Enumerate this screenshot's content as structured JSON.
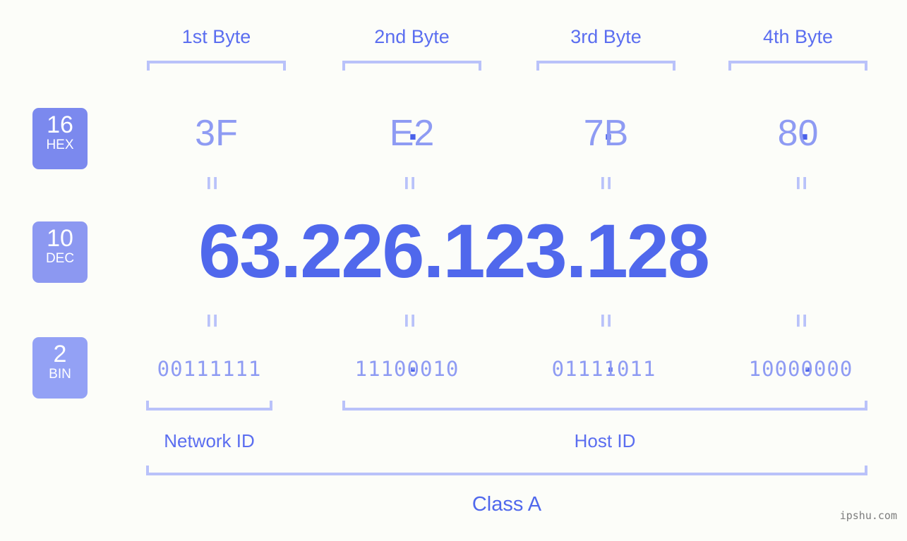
{
  "background_color": "#fcfdf9",
  "accent_color": "#5068ec",
  "muted_accent_color": "#8e9bf3",
  "bracket_color": "#b9c2fa",
  "byte_headers": [
    {
      "label": "1st Byte"
    },
    {
      "label": "2nd Byte"
    },
    {
      "label": "3rd Byte"
    },
    {
      "label": "4th Byte"
    }
  ],
  "rows": {
    "hex": {
      "badge_number": "16",
      "badge_abbr": "HEX",
      "badge_color": "#7b89ee",
      "separator": ".",
      "values": [
        "3F",
        "E2",
        "7B",
        "80"
      ]
    },
    "dec": {
      "badge_number": "10",
      "badge_abbr": "DEC",
      "badge_color": "#8c98f1",
      "separator": ".",
      "values": [
        "63",
        "226",
        "123",
        "128"
      ],
      "full_value": "63.226.123.128"
    },
    "bin": {
      "badge_number": "2",
      "badge_abbr": "BIN",
      "badge_color": "#93a1f5",
      "separator": ".",
      "values": [
        "00111111",
        "11100010",
        "01111011",
        "10000000"
      ]
    }
  },
  "equivalence_symbol": "=",
  "segments": {
    "network_id": "Network ID",
    "host_id": "Host ID"
  },
  "class_label": "Class A",
  "watermark": "ipshu.com"
}
